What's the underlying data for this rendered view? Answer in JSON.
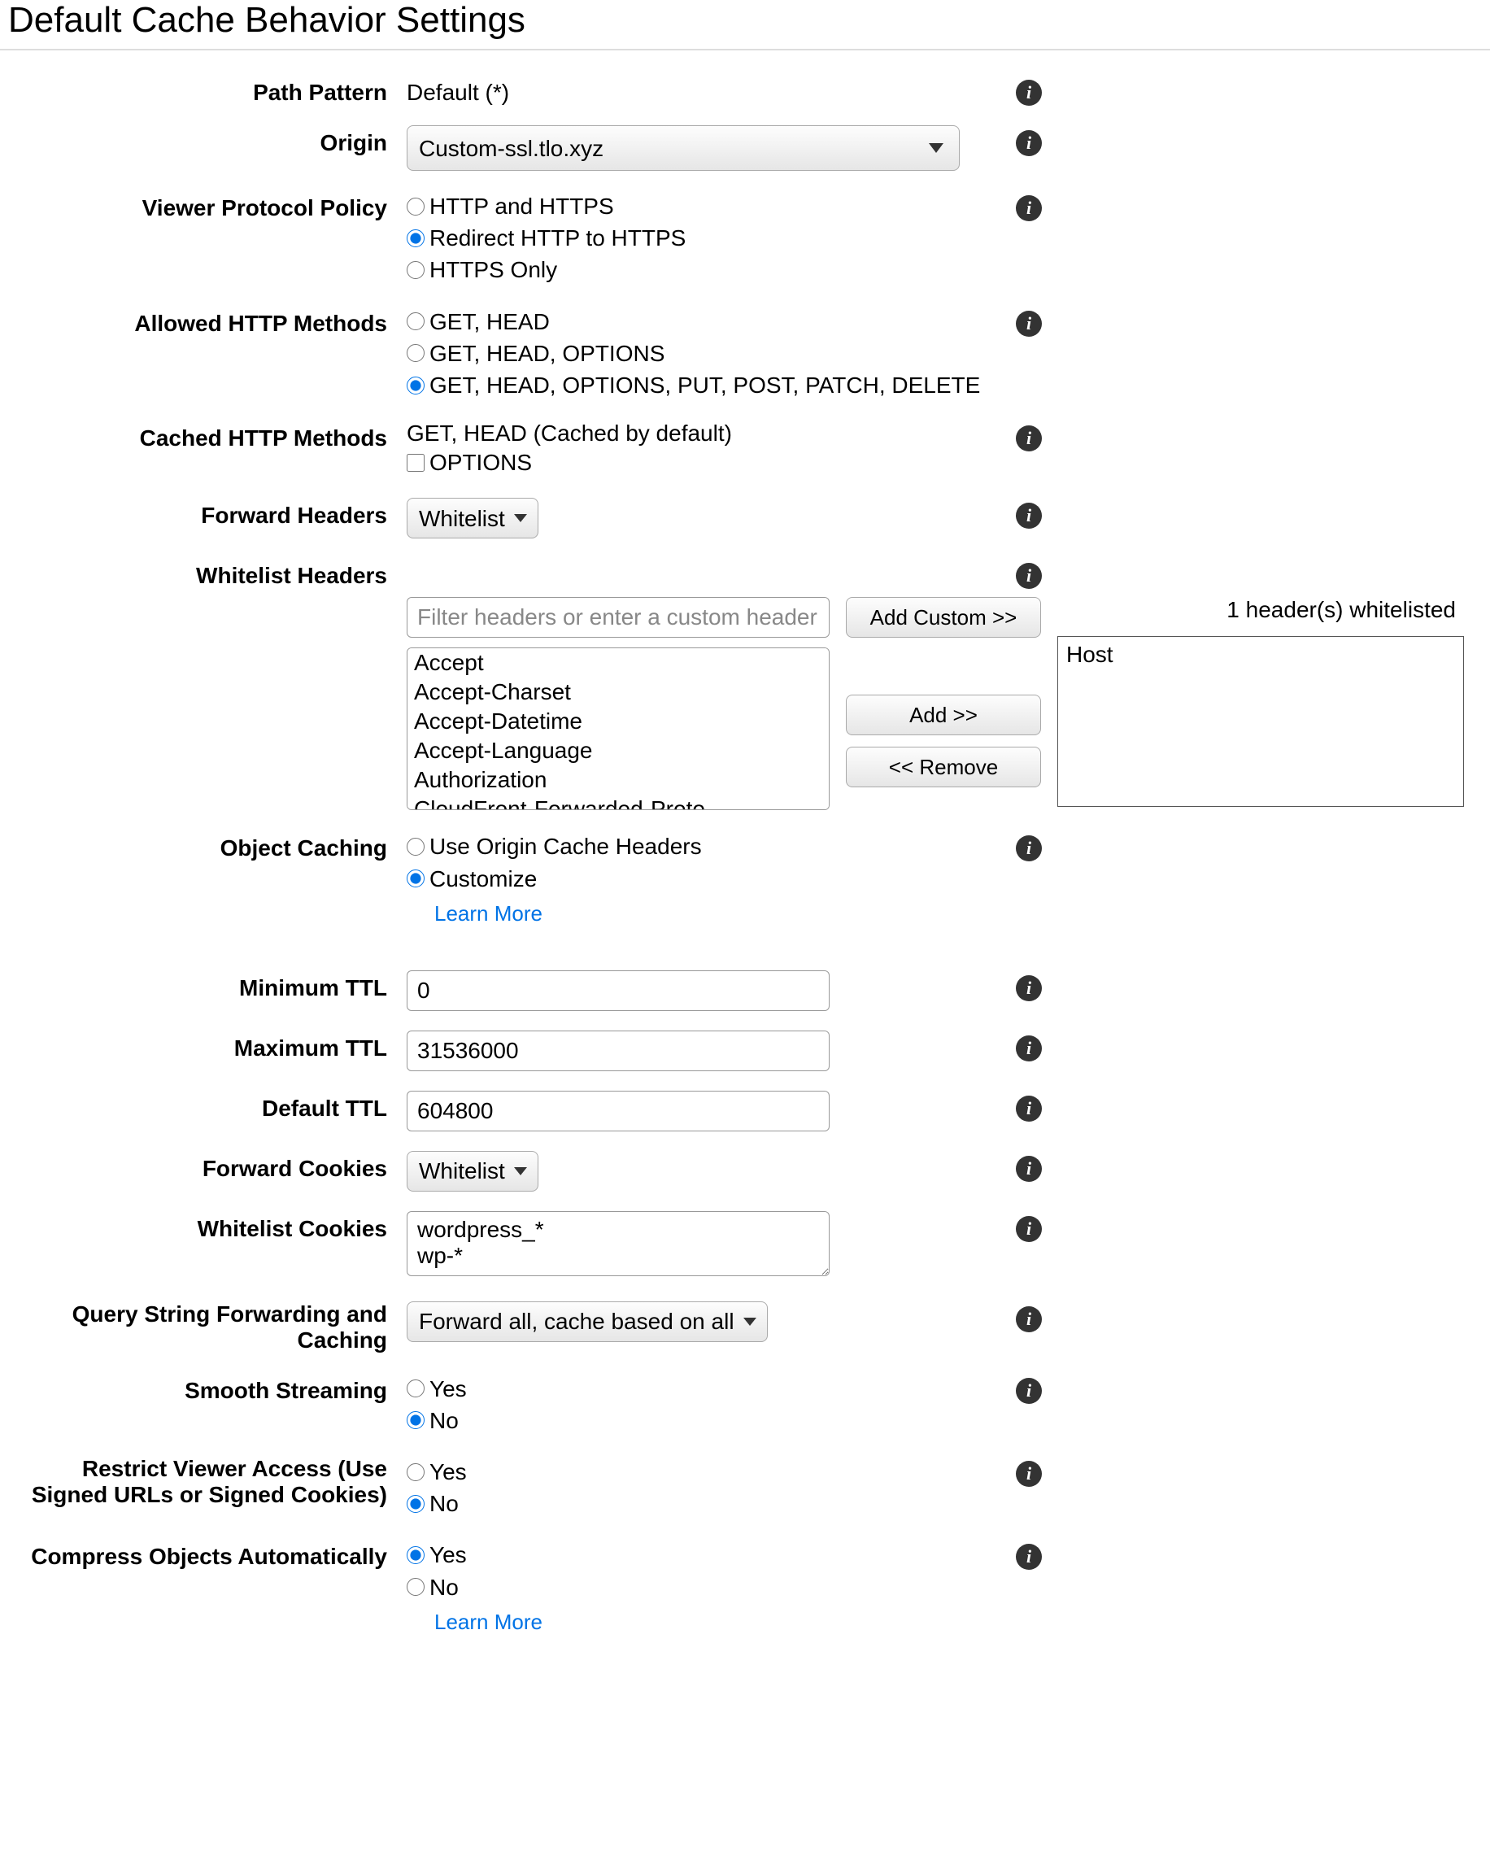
{
  "title": "Default Cache Behavior Settings",
  "labels": {
    "pathPattern": "Path Pattern",
    "origin": "Origin",
    "viewerProtocol": "Viewer Protocol Policy",
    "allowedMethods": "Allowed HTTP Methods",
    "cachedMethods": "Cached HTTP Methods",
    "forwardHeaders": "Forward Headers",
    "whitelistHeaders": "Whitelist Headers",
    "objectCaching": "Object Caching",
    "minTTL": "Minimum TTL",
    "maxTTL": "Maximum TTL",
    "defaultTTL": "Default TTL",
    "forwardCookies": "Forward Cookies",
    "whitelistCookies": "Whitelist Cookies",
    "queryString": "Query String Forwarding and Caching",
    "smoothStreaming": "Smooth Streaming",
    "restrictViewer": "Restrict Viewer Access (Use Signed URLs or Signed Cookies)",
    "compress": "Compress Objects Automatically"
  },
  "pathPattern": "Default (*)",
  "origin": {
    "selected": "Custom-ssl.tlo.xyz"
  },
  "viewerProtocol": {
    "opt1": "HTTP and HTTPS",
    "opt2": "Redirect HTTP to HTTPS",
    "opt3": "HTTPS Only"
  },
  "allowedMethods": {
    "opt1": "GET, HEAD",
    "opt2": "GET, HEAD, OPTIONS",
    "opt3": "GET, HEAD, OPTIONS, PUT, POST, PATCH, DELETE"
  },
  "cachedMethods": {
    "default": "GET, HEAD (Cached by default)",
    "opt1": "OPTIONS"
  },
  "forwardHeaders": {
    "selected": "Whitelist"
  },
  "whitelistHeaders": {
    "filterPlaceholder": "Filter headers or enter a custom header",
    "available": [
      "Accept",
      "Accept-Charset",
      "Accept-Datetime",
      "Accept-Language",
      "Authorization",
      "CloudFront-Forwarded-Proto"
    ],
    "addCustom": "Add Custom >>",
    "add": "Add >>",
    "remove": "<< Remove",
    "countMsg": "1 header(s) whitelisted",
    "whitelisted": [
      "Host"
    ]
  },
  "objectCaching": {
    "opt1": "Use Origin Cache Headers",
    "opt2": "Customize",
    "learnMore": "Learn More"
  },
  "minTTL": "0",
  "maxTTL": "31536000",
  "defaultTTL": "604800",
  "forwardCookies": {
    "selected": "Whitelist"
  },
  "whitelistCookies": "wordpress_*\nwp-*",
  "queryString": {
    "selected": "Forward all, cache based on all"
  },
  "yesNo": {
    "yes": "Yes",
    "no": "No"
  },
  "learnMore2": "Learn More"
}
